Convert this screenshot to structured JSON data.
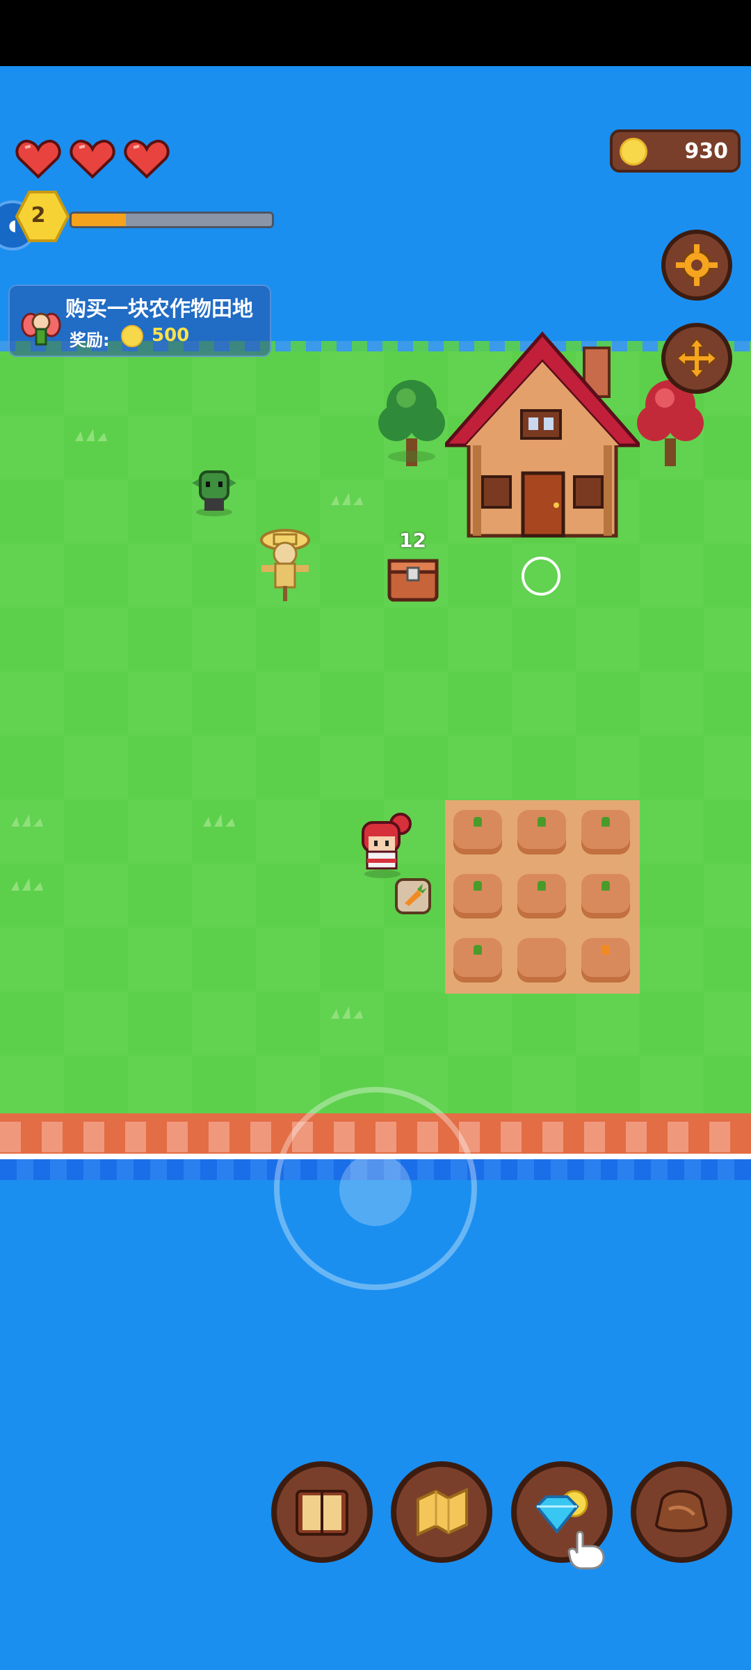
{
  "hud": {
    "hearts": 3,
    "level": "2",
    "xp_fraction": 0.27,
    "coins": "930"
  },
  "quest": {
    "title": "购买一块农作物田地",
    "reward_label": "奖励:",
    "reward_amount": "500"
  },
  "world": {
    "chest_count": "12"
  },
  "colors": {
    "water": "#1a8ff0",
    "grass": "#5cd04a",
    "accent": "#f5a21f"
  },
  "buttons": [
    "settings-icon",
    "move-icon",
    "book-icon",
    "map-icon",
    "gem-shop-icon",
    "bag-icon"
  ]
}
